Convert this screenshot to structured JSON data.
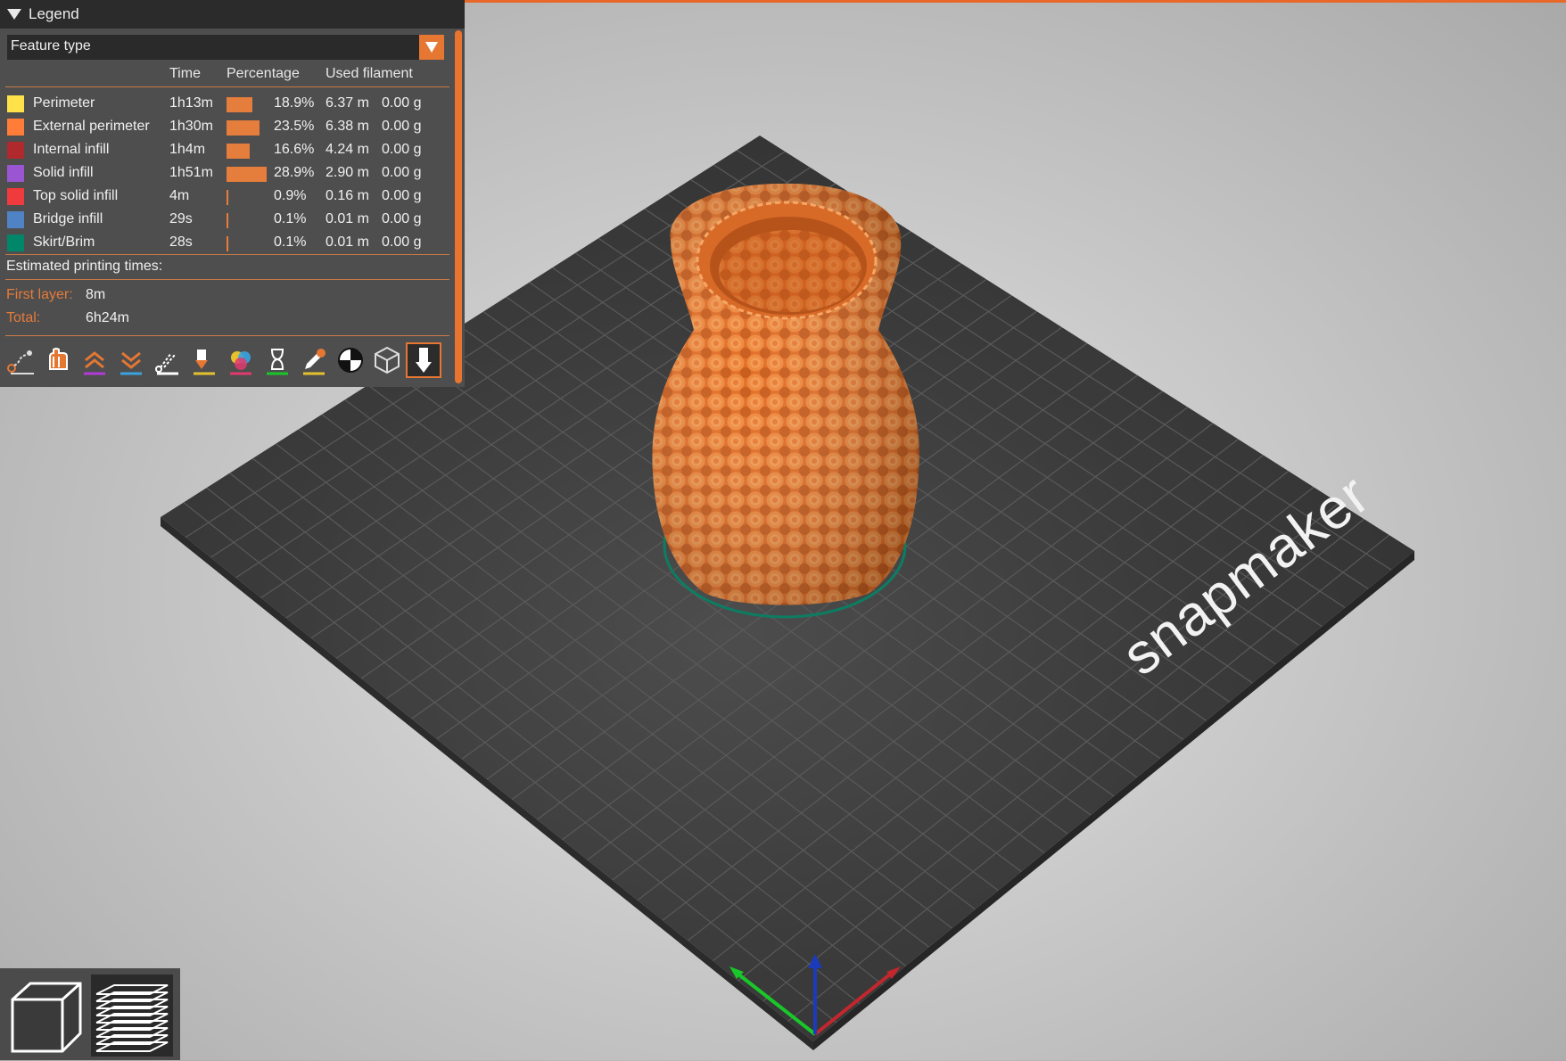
{
  "legend": {
    "title": "Legend",
    "view_type": "Feature type",
    "headers": {
      "time": "Time",
      "percentage": "Percentage",
      "used_filament": "Used filament"
    },
    "rows": [
      {
        "name": "Perimeter",
        "color": "#ffe24a",
        "time": "1h13m",
        "percent": "18.9%",
        "percent_value": 18.9,
        "length": "6.37 m",
        "weight": "0.00 g"
      },
      {
        "name": "External perimeter",
        "color": "#ff7d38",
        "time": "1h30m",
        "percent": "23.5%",
        "percent_value": 23.5,
        "length": "6.38 m",
        "weight": "0.00 g"
      },
      {
        "name": "Internal infill",
        "color": "#b0292c",
        "time": "1h4m",
        "percent": "16.6%",
        "percent_value": 16.6,
        "length": "4.24 m",
        "weight": "0.00 g"
      },
      {
        "name": "Solid infill",
        "color": "#9a55d2",
        "time": "1h51m",
        "percent": "28.9%",
        "percent_value": 28.9,
        "length": "2.90 m",
        "weight": "0.00 g"
      },
      {
        "name": "Top solid infill",
        "color": "#ef3a3e",
        "time": "4m",
        "percent": "0.9%",
        "percent_value": 0.9,
        "length": "0.16 m",
        "weight": "0.00 g"
      },
      {
        "name": "Bridge infill",
        "color": "#4f83c5",
        "time": "29s",
        "percent": "0.1%",
        "percent_value": 0.1,
        "length": "0.01 m",
        "weight": "0.00 g"
      },
      {
        "name": "Skirt/Brim",
        "color": "#00876a",
        "time": "28s",
        "percent": "0.1%",
        "percent_value": 0.1,
        "length": "0.01 m",
        "weight": "0.00 g"
      }
    ],
    "estimated_label": "Estimated printing times:",
    "first_layer_label": "First layer:",
    "first_layer_value": "8m",
    "total_label": "Total:",
    "total_value": "6h24m"
  },
  "toolbar": [
    "travel-icon",
    "wipe-icon",
    "retractions-icon",
    "deretractions-icon",
    "seams-icon",
    "tool-changes-icon",
    "color-changes-icon",
    "pause-prints-icon",
    "custom-gcode-icon",
    "cog-icon",
    "shells-icon",
    "tool-marker-icon"
  ],
  "bed": {
    "logo": "snapmaker"
  },
  "colors": {
    "accent": "#e57733",
    "model": "#e8732c",
    "bed": "#3a3a3a"
  },
  "view_buttons": [
    "3d-view-icon",
    "preview-layers-icon"
  ]
}
